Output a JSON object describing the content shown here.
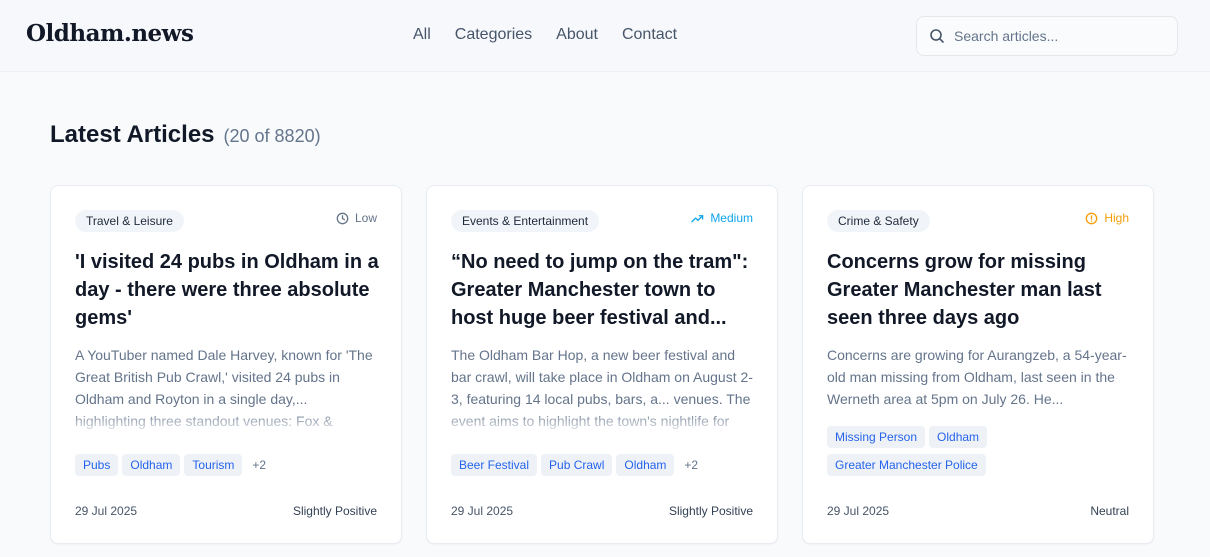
{
  "site": {
    "logo": "Oldham.news"
  },
  "nav": {
    "items": [
      "All",
      "Categories",
      "About",
      "Contact"
    ]
  },
  "search": {
    "placeholder": "Search articles..."
  },
  "section": {
    "title": "Latest Articles",
    "count": "(20 of 8820)"
  },
  "colors": {
    "low": "#64748b",
    "medium": "#0ea5e9",
    "high": "#f59e0b",
    "tag_text": "#2563eb"
  },
  "articles": [
    {
      "category": "Travel & Leisure",
      "importance": "Low",
      "importance_icon": "clock-icon",
      "title": "'I visited 24 pubs in Oldham in a day - there were three absolute gems'",
      "excerpt": "A YouTuber named Dale Harvey, known for 'The Great British Pub Crawl,' visited 24 pubs in Oldham and Royton in a single day,... highlighting three standout venues: Fox & Pheasant, the Ashton Arms and the Hark to Topper.",
      "tags": [
        "Pubs",
        "Oldham",
        "Tourism"
      ],
      "more_tags": "+2",
      "date": "29 Jul 2025",
      "sentiment": "Slightly Positive"
    },
    {
      "category": "Events & Entertainment",
      "importance": "Medium",
      "importance_icon": "trending-up-icon",
      "title": "“No need to jump on the tram\": Greater Manchester town to host huge beer festival and...",
      "excerpt": "The Oldham Bar Hop, a new beer festival and bar crawl, will take place in Oldham on August 2-3, featuring 14 local pubs, bars, a... venues. The event aims to highlight the town's nightlife for beer lovers.",
      "tags": [
        "Beer Festival",
        "Pub Crawl",
        "Oldham"
      ],
      "more_tags": "+2",
      "date": "29 Jul 2025",
      "sentiment": "Slightly Positive"
    },
    {
      "category": "Crime & Safety",
      "importance": "High",
      "importance_icon": "alert-circle-icon",
      "title": "Concerns grow for missing Greater Manchester man last seen three days ago",
      "excerpt": "Concerns are growing for Aurangzeb, a 54-year-old man missing from Oldham, last seen in the Werneth area at 5pm on July 26. He...",
      "tags": [
        "Missing Person",
        "Oldham",
        "Greater Manchester Police"
      ],
      "more_tags": "",
      "date": "29 Jul 2025",
      "sentiment": "Neutral"
    }
  ]
}
